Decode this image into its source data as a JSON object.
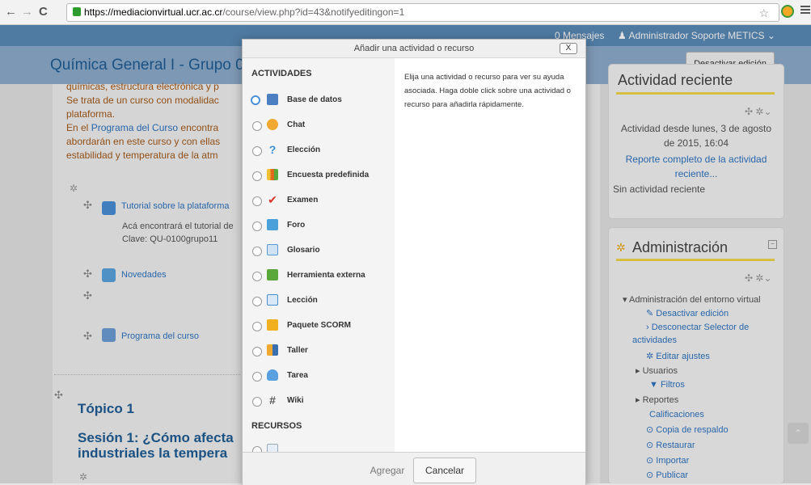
{
  "browser": {
    "url_host": "https://mediacionvirtual.ucr.ac.cr",
    "url_path": "/course/view.php?id=43&notifyeditingon=1"
  },
  "topbar": {
    "messages": "0 Mensajes",
    "user": "Administrador Soporte METICS"
  },
  "header": {
    "course_title": "Química General I - Grupo 0",
    "edit_button": "Desactivar edición"
  },
  "main": {
    "summary_lines": [
      "químicas, estructura electrónica y p",
      "Se trata de un curso con modalidac",
      "plataforma.",
      "abordarán en este curso y con ellas",
      "estabilidad y temperatura de la atm"
    ],
    "summary_link_prefix": "En el ",
    "summary_link": "Programa del Curso",
    "summary_link_suffix": " encontra",
    "tutorial_link": "Tutorial sobre la plataforma",
    "tutorial_desc": "Acá encontrará el tutorial de",
    "tutorial_key": "Clave:  QU-0100grupo11",
    "news_link": "Novedades",
    "program_link": "Programa del curso",
    "topic": "Tópico 1",
    "session": "Sesión 1: ¿Cómo afecta industriales la tempera"
  },
  "modal": {
    "title": "Añadir una actividad o recurso",
    "close": "X",
    "activities_header": "ACTIVIDADES",
    "activities": [
      {
        "label": "Base de datos",
        "icon": "database-icon",
        "color": "#4a7fc1"
      },
      {
        "label": "Chat",
        "icon": "chat-icon",
        "color": "#f0a830"
      },
      {
        "label": "Elección",
        "icon": "question-icon",
        "color": "#3a8fd8"
      },
      {
        "label": "Encuesta predefinida",
        "icon": "bar-chart-icon",
        "color": "#e06a1a"
      },
      {
        "label": "Examen",
        "icon": "checkmark-icon",
        "color": "#d9342b"
      },
      {
        "label": "Foro",
        "icon": "forum-icon",
        "color": "#4aa0d8"
      },
      {
        "label": "Glosario",
        "icon": "glossary-icon",
        "color": "#5a9bd5"
      },
      {
        "label": "Herramienta externa",
        "icon": "puzzle-icon",
        "color": "#5aa83a"
      },
      {
        "label": "Lección",
        "icon": "lesson-icon",
        "color": "#4a8fd0"
      },
      {
        "label": "Paquete SCORM",
        "icon": "scorm-icon",
        "color": "#f0b020"
      },
      {
        "label": "Taller",
        "icon": "workshop-icon",
        "color": "#3a6fb0"
      },
      {
        "label": "Tarea",
        "icon": "assignment-icon",
        "color": "#5aa0e0"
      },
      {
        "label": "Wiki",
        "icon": "wiki-icon",
        "color": "#666666"
      }
    ],
    "resources_header": "RECURSOS",
    "help_text": "Elija una actividad o recurso para ver su ayuda asociada. Haga doble click sobre una actividad o recurso para añadirla rápidamente.",
    "add_button": "Agregar",
    "cancel_button": "Cancelar"
  },
  "recent": {
    "title": "Actividad reciente",
    "since": "Actividad desde lunes, 3 de agosto de 2015, 16:04",
    "full_report": "Reporte completo de la actividad reciente...",
    "none": "Sin actividad reciente"
  },
  "admin": {
    "title": "Administración",
    "root": "Administración del entorno virtual",
    "items": [
      "Desactivar edición",
      "Desconectar Selector de",
      "actividades",
      "Editar ajustes",
      "Usuarios",
      "Filtros",
      "Reportes",
      "Calificaciones",
      "Copia de respaldo",
      "Restaurar",
      "Importar",
      "Publicar"
    ]
  },
  "colors": {
    "accent": "#2f75c2",
    "topbar": "#5b8bb8",
    "highlight": "#f3d94a"
  }
}
